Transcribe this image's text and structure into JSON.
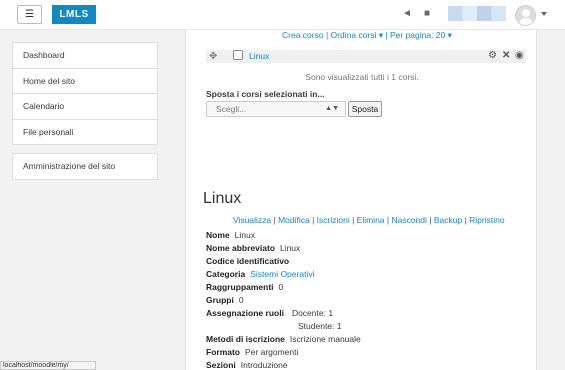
{
  "navbar": {
    "menu_icon": "hamburger-icon",
    "brand": "LMLS",
    "icons": [
      "bell-icon",
      "message-icon"
    ],
    "avatar": "user-avatar"
  },
  "sidebar": {
    "items": [
      {
        "label": "Dashboard"
      },
      {
        "label": "Home del sito"
      },
      {
        "label": "Calendario"
      },
      {
        "label": "File personali"
      }
    ],
    "admin": {
      "label": "Amministrazione del sito"
    }
  },
  "controls": {
    "crea": "Crea corso",
    "ordina": "Ordina corsi ▾",
    "per_pagina": "Per pagina: 20 ▾",
    "sep": "|"
  },
  "course_row": {
    "name": "Linux"
  },
  "showing_text": "Sono visualizzati tutti i 1 corsi.",
  "move": {
    "label": "Sposta i corsi selezionati in...",
    "select_value": "Scegli...",
    "button": "Sposta"
  },
  "course": {
    "title": "Linux",
    "actions": [
      "Visualizza",
      "Modifica",
      "Iscrizioni",
      "Elimina",
      "Nascondi",
      "Backup",
      "Ripristino"
    ],
    "details": [
      {
        "label": "Nome",
        "value": "Linux"
      },
      {
        "label": "Nome abbreviato",
        "value": "Linux"
      },
      {
        "label": "Codice identificativo",
        "value": ""
      },
      {
        "label": "Categoria",
        "value": "Sistemi Operativi",
        "link": true
      },
      {
        "label": "Raggruppamenti",
        "value": "0"
      },
      {
        "label": "Gruppi",
        "value": "0"
      },
      {
        "label": "Assegnazione ruoli",
        "value": "Docente: 1"
      },
      {
        "label": "",
        "value": "Studente: 1"
      },
      {
        "label": "Metodi di iscrizione",
        "value": "Iscrizione manuale"
      },
      {
        "label": "Formato",
        "value": "Per argomenti"
      },
      {
        "label": "Sezioni",
        "value": "Introduzione"
      }
    ]
  },
  "status_bar": "localhost/moodle/my/"
}
